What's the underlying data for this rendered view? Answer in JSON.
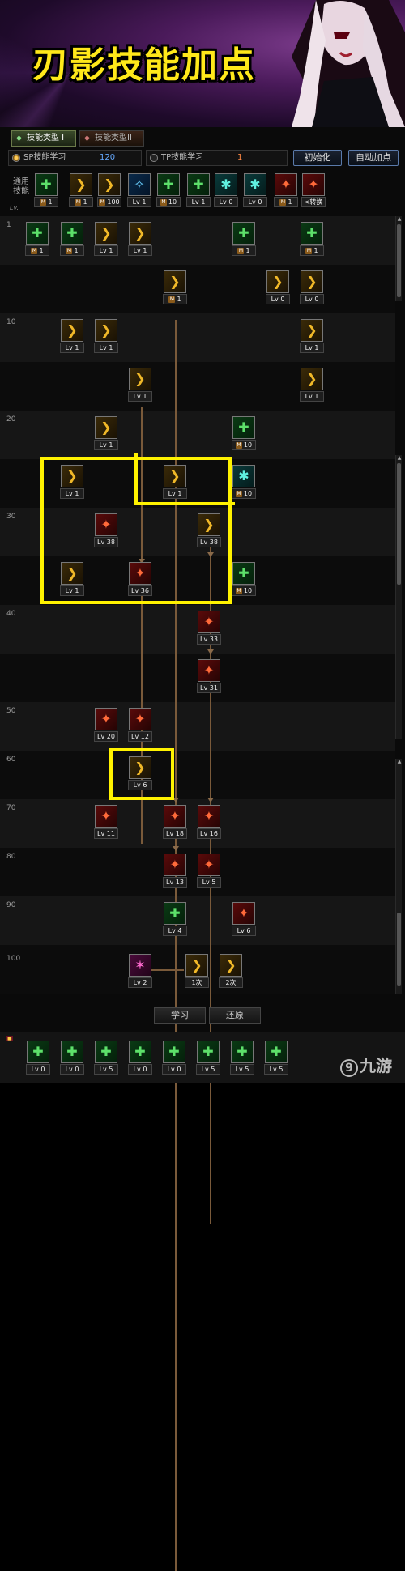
{
  "banner": {
    "title": "刃影技能加点"
  },
  "tabs": [
    {
      "label": "技能类型 I",
      "active": true
    },
    {
      "label": "技能类型II",
      "active": false
    }
  ],
  "sp": {
    "label": "SP技能学习",
    "points": "120",
    "selected": true
  },
  "tp": {
    "label": "TP技能学习",
    "points": "1",
    "selected": false
  },
  "buttons": {
    "reset": "初始化",
    "auto": "自动加点",
    "learn": "学习",
    "revert": "还原"
  },
  "general": {
    "label": "通用技能",
    "lv_header": "Lv."
  },
  "general_skills": [
    {
      "caption": "1",
      "badge": true,
      "color": "g"
    },
    {
      "caption": "1",
      "badge": true,
      "color": "y"
    },
    {
      "caption": "100",
      "badge": true,
      "color": "y"
    },
    {
      "caption": "Lv 1",
      "badge": false,
      "color": "b"
    },
    {
      "caption": "10",
      "badge": true,
      "color": "g"
    },
    {
      "caption": "Lv 1",
      "badge": false,
      "color": "g"
    },
    {
      "caption": "Lv 0",
      "badge": false,
      "color": "t"
    },
    {
      "caption": "Lv 0",
      "badge": false,
      "color": "t"
    },
    {
      "caption": "1",
      "badge": true,
      "color": "r"
    },
    {
      "caption": "<转换",
      "badge": false,
      "color": "r"
    }
  ],
  "levels": [
    "1",
    "10",
    "20",
    "30",
    "40",
    "50",
    "60",
    "70",
    "80",
    "90",
    "100"
  ],
  "skills": [
    {
      "caption": "1",
      "badge": true,
      "color": "g"
    },
    {
      "caption": "1",
      "badge": true,
      "color": "g"
    },
    {
      "caption": "Lv 1",
      "badge": false,
      "color": "y"
    },
    {
      "caption": "Lv 1",
      "badge": false,
      "color": "y"
    },
    {
      "caption": "1",
      "badge": true,
      "color": "g"
    },
    {
      "caption": "1",
      "badge": true,
      "color": "g"
    },
    {
      "caption": "1",
      "badge": true,
      "color": "y"
    },
    {
      "caption": "Lv 0",
      "badge": false,
      "color": "y"
    },
    {
      "caption": "Lv 0",
      "badge": false,
      "color": "y"
    },
    {
      "caption": "Lv 1",
      "badge": false,
      "color": "y"
    },
    {
      "caption": "Lv 1",
      "badge": false,
      "color": "y"
    },
    {
      "caption": "Lv 1",
      "badge": false,
      "color": "y"
    },
    {
      "caption": "Lv 1",
      "badge": false,
      "color": "y"
    },
    {
      "caption": "Lv 1",
      "badge": false,
      "color": "y"
    },
    {
      "caption": "Lv 1",
      "badge": false,
      "color": "y"
    },
    {
      "caption": "10",
      "badge": true,
      "color": "g"
    },
    {
      "caption": "Lv 1",
      "badge": false,
      "color": "y"
    },
    {
      "caption": "Lv 1",
      "badge": false,
      "color": "y"
    },
    {
      "caption": "10",
      "badge": true,
      "color": "t"
    },
    {
      "caption": "Lv 38",
      "badge": false,
      "color": "r"
    },
    {
      "caption": "Lv 38",
      "badge": false,
      "color": "y"
    },
    {
      "caption": "Lv 1",
      "badge": false,
      "color": "y"
    },
    {
      "caption": "Lv 36",
      "badge": false,
      "color": "r"
    },
    {
      "caption": "10",
      "badge": true,
      "color": "g"
    },
    {
      "caption": "Lv 33",
      "badge": false,
      "color": "r"
    },
    {
      "caption": "Lv 31",
      "badge": false,
      "color": "r"
    },
    {
      "caption": "Lv 20",
      "badge": false,
      "color": "r"
    },
    {
      "caption": "Lv 12",
      "badge": false,
      "color": "r"
    },
    {
      "caption": "Lv 6",
      "badge": false,
      "color": "y"
    },
    {
      "caption": "Lv 11",
      "badge": false,
      "color": "r"
    },
    {
      "caption": "Lv 18",
      "badge": false,
      "color": "r"
    },
    {
      "caption": "Lv 16",
      "badge": false,
      "color": "r"
    },
    {
      "caption": "Lv 13",
      "badge": false,
      "color": "r"
    },
    {
      "caption": "Lv 5",
      "badge": false,
      "color": "r"
    },
    {
      "caption": "Lv 4",
      "badge": false,
      "color": "g"
    },
    {
      "caption": "Lv 6",
      "badge": false,
      "color": "r"
    },
    {
      "caption": "Lv 2",
      "badge": false,
      "color": "p"
    },
    {
      "caption": "1次",
      "badge": false,
      "color": "y"
    },
    {
      "caption": "2次",
      "badge": false,
      "color": "y"
    }
  ],
  "quickbar": [
    {
      "caption": "Lv 0",
      "color": "g"
    },
    {
      "caption": "Lv 0",
      "color": "g"
    },
    {
      "caption": "Lv 5",
      "color": "g"
    },
    {
      "caption": "Lv 0",
      "color": "g"
    },
    {
      "caption": "Lv 0",
      "color": "g"
    },
    {
      "caption": "Lv 5",
      "color": "g"
    },
    {
      "caption": "Lv 5",
      "color": "g"
    },
    {
      "caption": "Lv 5",
      "color": "g"
    }
  ],
  "watermark": {
    "symbol": "9",
    "text": "九游"
  }
}
